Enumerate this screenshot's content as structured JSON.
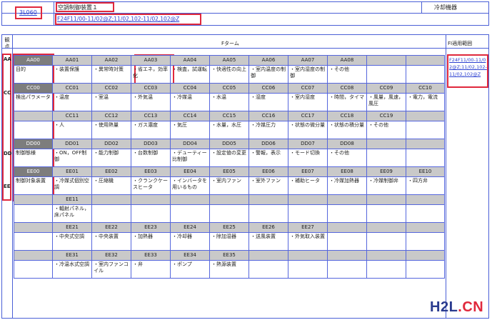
{
  "header": {
    "code": "3L060",
    "name": "空調制御装置１",
    "category": "冷却機器",
    "fi_range": "F24F11/00-11/02@Z;11/02,102-11/02,102@Z"
  },
  "table": {
    "viewpoint_label": "観点",
    "fterm_label": "Fターム",
    "fi_label": "FI適用範囲",
    "fi_value": "F24F11/00-11/02@Z;11/02,102-11/02,102@Z",
    "groups": [
      {
        "key": "AA",
        "code": "AA00",
        "title": "目的",
        "rows": [
          {
            "codes": [
              "AA01",
              "AA02",
              "AA03",
              "AA04",
              "AA05",
              "AA06",
              "AA07",
              "AA08",
              "",
              ""
            ],
            "texts": [
              "・装置保護",
              "・異常時対策",
              "・省エネ，効率化",
              "・検査，試運転",
              "・快適性の向上",
              "・室内温度の制御",
              "・室内湿度の制御",
              "・その他",
              "",
              ""
            ]
          }
        ]
      },
      {
        "key": "CC",
        "code": "CC00",
        "title": "検出パラメータ",
        "rows": [
          {
            "codes": [
              "CC01",
              "CC02",
              "CC03",
              "CC04",
              "CC05",
              "CC06",
              "CC07",
              "CC08",
              "CC09",
              "CC10"
            ],
            "texts": [
              "・温度",
              "・室温",
              "・外気温",
              "・冷媒温",
              "・水温",
              "・湿度",
              "・室内湿度",
              "・時間，タイマ",
              "・風量，風速，風圧",
              "・電力，電流"
            ]
          },
          {
            "codes": [
              "CC11",
              "CC12",
              "CC13",
              "CC14",
              "CC15",
              "CC16",
              "CC17",
              "CC18",
              "CC19",
              ""
            ],
            "texts": [
              "・人",
              "・使用熱量",
              "・ガス濃度",
              "・気圧",
              "・水量，水圧",
              "・冷媒圧力",
              "・状態の微分量",
              "・状態の積分量",
              "・その他",
              ""
            ]
          }
        ]
      },
      {
        "key": "DD",
        "code": "DD00",
        "title": "制御態様",
        "rows": [
          {
            "codes": [
              "DD01",
              "DD02",
              "DD03",
              "DD04",
              "DD05",
              "DD06",
              "DD07",
              "DD08",
              "",
              ""
            ],
            "texts": [
              "・ON，OFF制御",
              "・能力制御",
              "・台数制御",
              "・デューティー比制御",
              "・設定値の変更",
              "・警報，表示",
              "・モード切換",
              "・その他",
              "",
              ""
            ]
          }
        ]
      },
      {
        "key": "EE",
        "code": "EE00",
        "title": "制御対象装置",
        "rows": [
          {
            "codes": [
              "EE01",
              "EE02",
              "EE03",
              "EE04",
              "EE05",
              "EE06",
              "EE07",
              "EE08",
              "EE09",
              "EE10"
            ],
            "texts": [
              "・冷媒式個別空調",
              "・圧縮機",
              "・クランクケースヒータ",
              "・インバータを用いるもの",
              "・室内ファン",
              "・室外ファン",
              "・補助ヒータ",
              "・冷媒加熱器",
              "・冷媒制御弁",
              "・四方弁"
            ]
          },
          {
            "codes": [
              "EE11",
              "",
              "",
              "",
              "",
              "",
              "",
              "",
              "",
              ""
            ],
            "texts": [
              "・輻射パネル，床パネル",
              "",
              "",
              "",
              "",
              "",
              "",
              "",
              "",
              ""
            ]
          },
          {
            "codes": [
              "EE21",
              "EE22",
              "EE23",
              "EE24",
              "EE25",
              "EE26",
              "EE27",
              "",
              "",
              ""
            ],
            "texts": [
              "・中央式空調",
              "・中央装置",
              "・加熱器",
              "・冷却器",
              "・除加湿器",
              "・送風装置",
              "・外気取入装置",
              "",
              "",
              ""
            ]
          },
          {
            "codes": [
              "EE31",
              "EE32",
              "EE33",
              "EE34",
              "EE35",
              "",
              "",
              "",
              "",
              ""
            ],
            "texts": [
              "・冷温水式空調",
              "・室内ファンコイル",
              "・弁",
              "・ポンプ",
              "・熱源装置",
              "",
              "",
              "",
              "",
              ""
            ]
          }
        ]
      }
    ]
  },
  "watermark": {
    "main": "H2L",
    "suffix": ".CN"
  },
  "colors": {
    "border": "#4a5fd6",
    "highlight": "#e0283c",
    "link": "#2b3fd0",
    "group_header": "#7d7d7d",
    "code_header": "#c9c9c9"
  }
}
